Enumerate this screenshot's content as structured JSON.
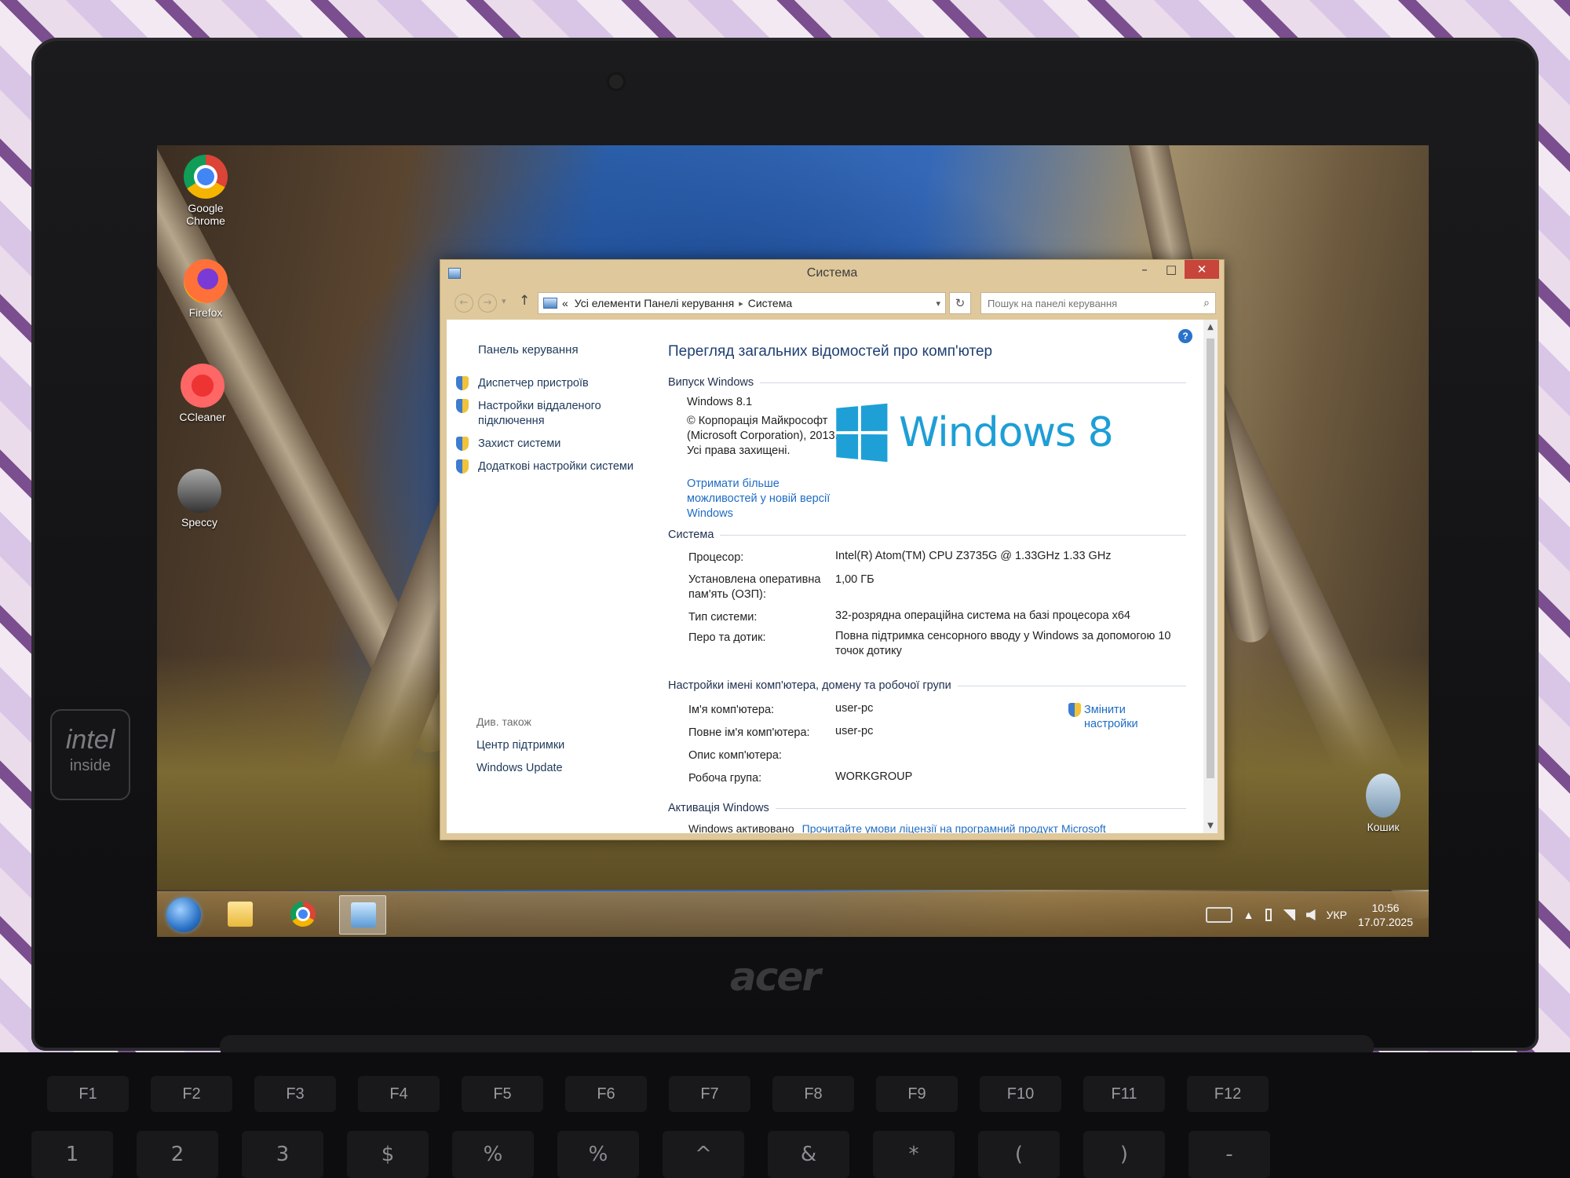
{
  "window": {
    "title": "Система",
    "minimize": "–",
    "maximize": "□",
    "close": "✕"
  },
  "addressbar": {
    "back": "←",
    "forward": "→",
    "dropdown": "▾",
    "up": "↑",
    "prefix": "«",
    "crumb_1": "Усі елементи Панелі керування",
    "crumb_sep": "▸",
    "crumb_2": "Система",
    "crumb_dropdown": "▾",
    "refresh": "↻",
    "search_placeholder": "Пошук на панелі керування",
    "search_icon": "⌕"
  },
  "sidebar": {
    "home": "Панель керування",
    "links": [
      {
        "label": "Диспетчер пристроїв"
      },
      {
        "label": "Настройки віддаленого підключення"
      },
      {
        "label": "Захист системи"
      },
      {
        "label": "Додаткові настройки системи"
      }
    ],
    "see_also": "Див. також",
    "see_also_links": [
      "Центр підтримки",
      "Windows Update"
    ]
  },
  "main": {
    "help": "?",
    "heading": "Перегляд загальних відомостей про комп'ютер",
    "edition_section": "Випуск Windows",
    "edition_name": "Windows 8.1",
    "copyright": "© Корпорація Майкрософт (Microsoft Corporation), 2013. Усі права захищені.",
    "upgrade_link": "Отримати більше можливостей у новій версії Windows",
    "logo_text": "Windows 8",
    "system_section": "Система",
    "system_rows": [
      {
        "label": "Процесор:",
        "value": "Intel(R) Atom(TM) CPU  Z3735G @ 1.33GHz   1.33 GHz"
      },
      {
        "label": "Установлена оперативна пам'ять (ОЗП):",
        "value": "1,00 ГБ"
      },
      {
        "label": "Тип системи:",
        "value": "32-розрядна операційна система на базі процесора x64"
      },
      {
        "label": "Перо та дотик:",
        "value": "Повна підтримка сенсорного вводу у Windows за допомогою 10 точок дотику"
      }
    ],
    "name_section": "Настройки імені комп'ютера, домену та робочої групи",
    "name_rows": [
      {
        "label": "Ім'я комп'ютера:",
        "value": "user-pc"
      },
      {
        "label": "Повне ім'я комп'ютера:",
        "value": "user-pc"
      },
      {
        "label": "Опис комп'ютера:",
        "value": ""
      },
      {
        "label": "Робоча група:",
        "value": "WORKGROUP"
      }
    ],
    "change_link": "Змінити настройки",
    "activation_section": "Активація Windows",
    "activation_cut_text": "Windows активовано",
    "activation_cut_link": "Прочитайте умови ліцензії на програмний продукт Microsoft"
  },
  "desktop": {
    "icons": [
      {
        "label": "Google Chrome",
        "icon": "chrome-icon"
      },
      {
        "label": "Firefox",
        "icon": "firefox-icon"
      },
      {
        "label": "CCleaner",
        "icon": "ccleaner-icon"
      },
      {
        "label": "Speccy",
        "icon": "speccy-icon"
      },
      {
        "label": "Кошик",
        "icon": "recycle-bin-icon"
      }
    ]
  },
  "taskbar": {
    "tray_up": "▲",
    "lang": "УКР",
    "time": "10:56",
    "date": "17.07.2025"
  },
  "hardware": {
    "brand": "acer",
    "badge_top": "intel",
    "badge_bottom": "inside",
    "fkeys": [
      "F1",
      "F2",
      "F3",
      "F4",
      "F5",
      "F6",
      "F7",
      "F8",
      "F9",
      "F10",
      "F11",
      "F12"
    ],
    "row2": [
      "1",
      "2",
      "3",
      "$",
      "%",
      "%",
      "^",
      "&",
      "*",
      "(",
      ")",
      "-"
    ]
  },
  "colors": {
    "accent_title": "#dfc89b",
    "link_blue": "#1f6cc4",
    "heading_blue": "#1e3f73",
    "win8_blue": "#1e9ed6",
    "close_red": "#c7453b"
  }
}
